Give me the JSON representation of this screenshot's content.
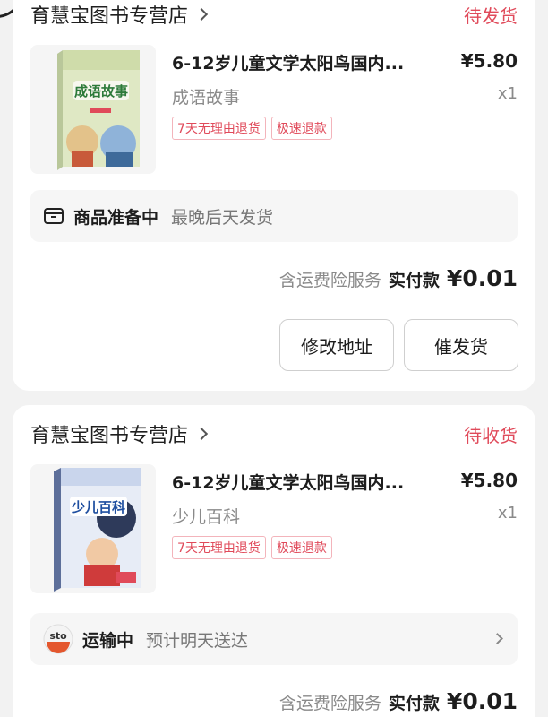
{
  "orders": [
    {
      "store": "育慧宝图书专营店",
      "status": "待发货",
      "product": {
        "title": "6-12岁儿童文学太阳鸟国内...",
        "price": "¥5.80",
        "variant": "成语故事",
        "qty": "x1",
        "cover_title": "成语故事",
        "tags": [
          "7天无理由退货",
          "极速退款"
        ]
      },
      "info": {
        "bold": "商品准备中",
        "light": "最晚后天发货",
        "icon": "package-box-icon"
      },
      "payment": {
        "insurance": "含运费险服务",
        "key": "实付款",
        "amount": "¥0.01"
      },
      "buttons": [
        "修改地址",
        "催发货"
      ]
    },
    {
      "store": "育慧宝图书专营店",
      "status": "待收货",
      "product": {
        "title": "6-12岁儿童文学太阳鸟国内...",
        "price": "¥5.80",
        "variant": "少儿百科",
        "qty": "x1",
        "cover_title": "少儿百科",
        "tags": [
          "7天无理由退货",
          "极速退款"
        ]
      },
      "info": {
        "bold": "运输中",
        "light": "预计明天送达",
        "icon": "sto-express-logo"
      },
      "payment": {
        "insurance": "含运费险服务",
        "key": "实付款",
        "amount": "¥0.01"
      }
    }
  ],
  "colors": {
    "status": "#e04a5a",
    "tag_border": "#f3b4bb",
    "background": "#f2f2f2"
  }
}
